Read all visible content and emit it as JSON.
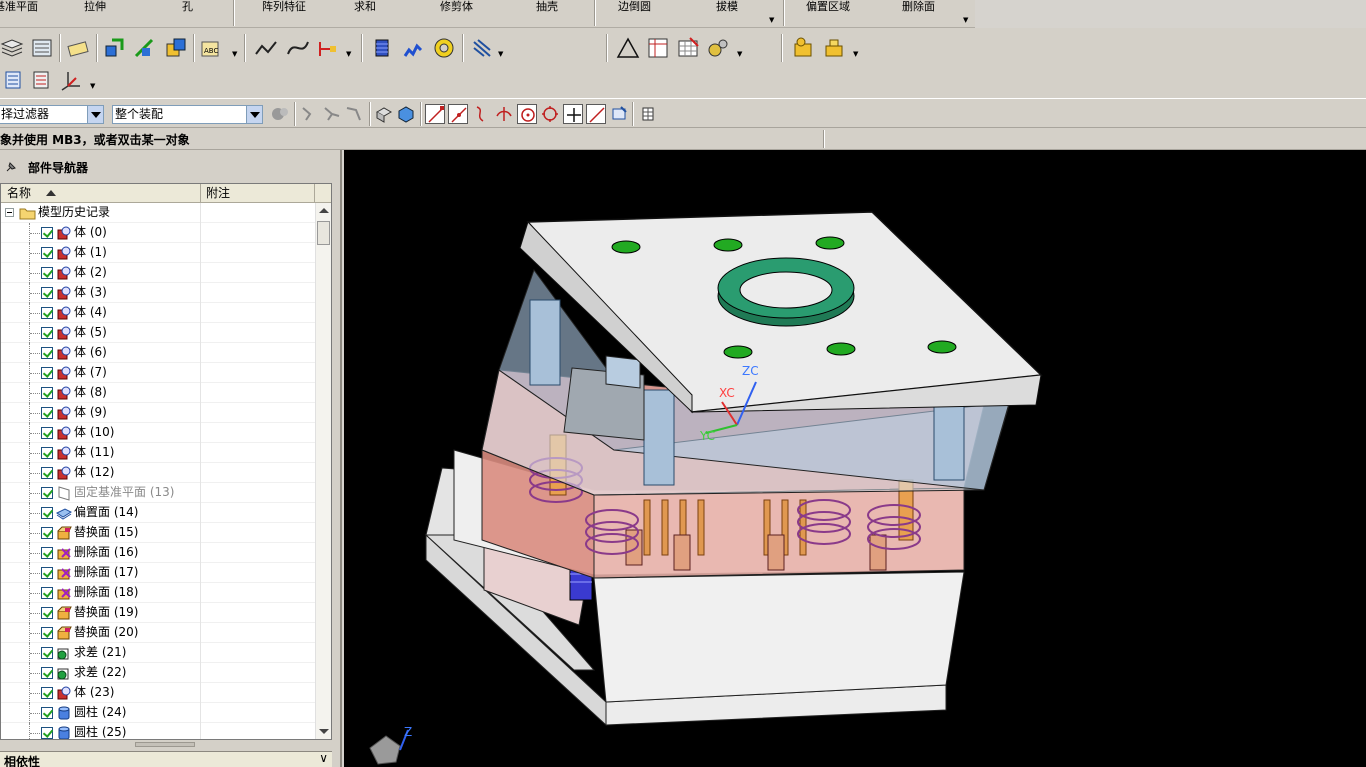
{
  "feature_toolbar": {
    "items": [
      "基准平面",
      "拉伸",
      "孔",
      "阵列特征",
      "求和",
      "修剪体",
      "抽壳",
      "边倒圆",
      "拔模",
      "偏置区域",
      "删除面"
    ]
  },
  "icon_toolbars": {
    "icons": [
      "layer-icon",
      "layer-settings-icon",
      "edit-icon",
      "assembly-icon",
      "move-icon",
      "reposition-icon",
      "text-note-icon",
      "sketch-line-icon",
      "curve-icon",
      "dimension-icon",
      "cylinder-icon",
      "spring-icon",
      "ring-icon",
      "pattern-icon",
      "triangle-icon",
      "table-icon",
      "grid-insert-icon",
      "gear-settings-icon",
      "mold-wizard-icon",
      "mold-tools-icon",
      "component-list-icon",
      "parts-list-icon",
      "csys-icon"
    ]
  },
  "selection_bar": {
    "filter_value": "择过滤器",
    "scope_value": "整个装配",
    "snap_icons": [
      "endpoint-snap-icon",
      "midpoint-snap-icon",
      "control-point-icon",
      "intersection-icon",
      "arc-center-icon",
      "quadrant-icon",
      "point-on-curve-icon",
      "point-on-face-icon"
    ]
  },
  "cue_line": {
    "text": "象并使用 MB3，或者双击某一对象"
  },
  "navigator": {
    "title": "部件导航器",
    "columns": {
      "name": "名称",
      "note": "附注"
    },
    "root": "模型历史记录",
    "rows": [
      {
        "label": "体 (0)",
        "icon": "body-icon",
        "dim": false
      },
      {
        "label": "体 (1)",
        "icon": "body-icon",
        "dim": false
      },
      {
        "label": "体 (2)",
        "icon": "body-icon",
        "dim": false
      },
      {
        "label": "体 (3)",
        "icon": "body-icon",
        "dim": false
      },
      {
        "label": "体 (4)",
        "icon": "body-icon",
        "dim": false
      },
      {
        "label": "体 (5)",
        "icon": "body-icon",
        "dim": false
      },
      {
        "label": "体 (6)",
        "icon": "body-icon",
        "dim": false
      },
      {
        "label": "体 (7)",
        "icon": "body-icon",
        "dim": false
      },
      {
        "label": "体 (8)",
        "icon": "body-icon",
        "dim": false
      },
      {
        "label": "体 (9)",
        "icon": "body-icon",
        "dim": false
      },
      {
        "label": "体 (10)",
        "icon": "body-icon",
        "dim": false
      },
      {
        "label": "体 (11)",
        "icon": "body-icon",
        "dim": false
      },
      {
        "label": "体 (12)",
        "icon": "body-icon",
        "dim": false
      },
      {
        "label": "固定基准平面 (13)",
        "icon": "datum-plane-icon",
        "dim": true
      },
      {
        "label": "偏置面 (14)",
        "icon": "offset-face-icon",
        "dim": false
      },
      {
        "label": "替换面 (15)",
        "icon": "replace-face-icon",
        "dim": false
      },
      {
        "label": "删除面 (16)",
        "icon": "delete-face-icon",
        "dim": false
      },
      {
        "label": "删除面 (17)",
        "icon": "delete-face-icon",
        "dim": false
      },
      {
        "label": "删除面 (18)",
        "icon": "delete-face-icon",
        "dim": false
      },
      {
        "label": "替换面 (19)",
        "icon": "replace-face-icon",
        "dim": false
      },
      {
        "label": "替换面 (20)",
        "icon": "replace-face-icon",
        "dim": false
      },
      {
        "label": "求差 (21)",
        "icon": "subtract-icon",
        "dim": false
      },
      {
        "label": "求差 (22)",
        "icon": "subtract-icon",
        "dim": false
      },
      {
        "label": "体 (23)",
        "icon": "body-icon",
        "dim": false
      },
      {
        "label": "圆柱 (24)",
        "icon": "cylinder-feature-icon",
        "dim": false
      },
      {
        "label": "圆柱 (25)",
        "icon": "cylinder-feature-icon",
        "dim": false
      }
    ],
    "dependency_panel": "相依性"
  },
  "viewport": {
    "background": "#000000",
    "wcs_labels": {
      "x": "XC",
      "y": "YC",
      "z": "ZC"
    },
    "triad_label": "Z"
  },
  "colors": {
    "toolbar_bg": "#d4d0c8",
    "mold_plate": "#ececec",
    "cavity_plate": "#d98c80",
    "core_plate": "#e8a39a",
    "ring": "#2a9c70",
    "spring": "#3a3ad0"
  }
}
